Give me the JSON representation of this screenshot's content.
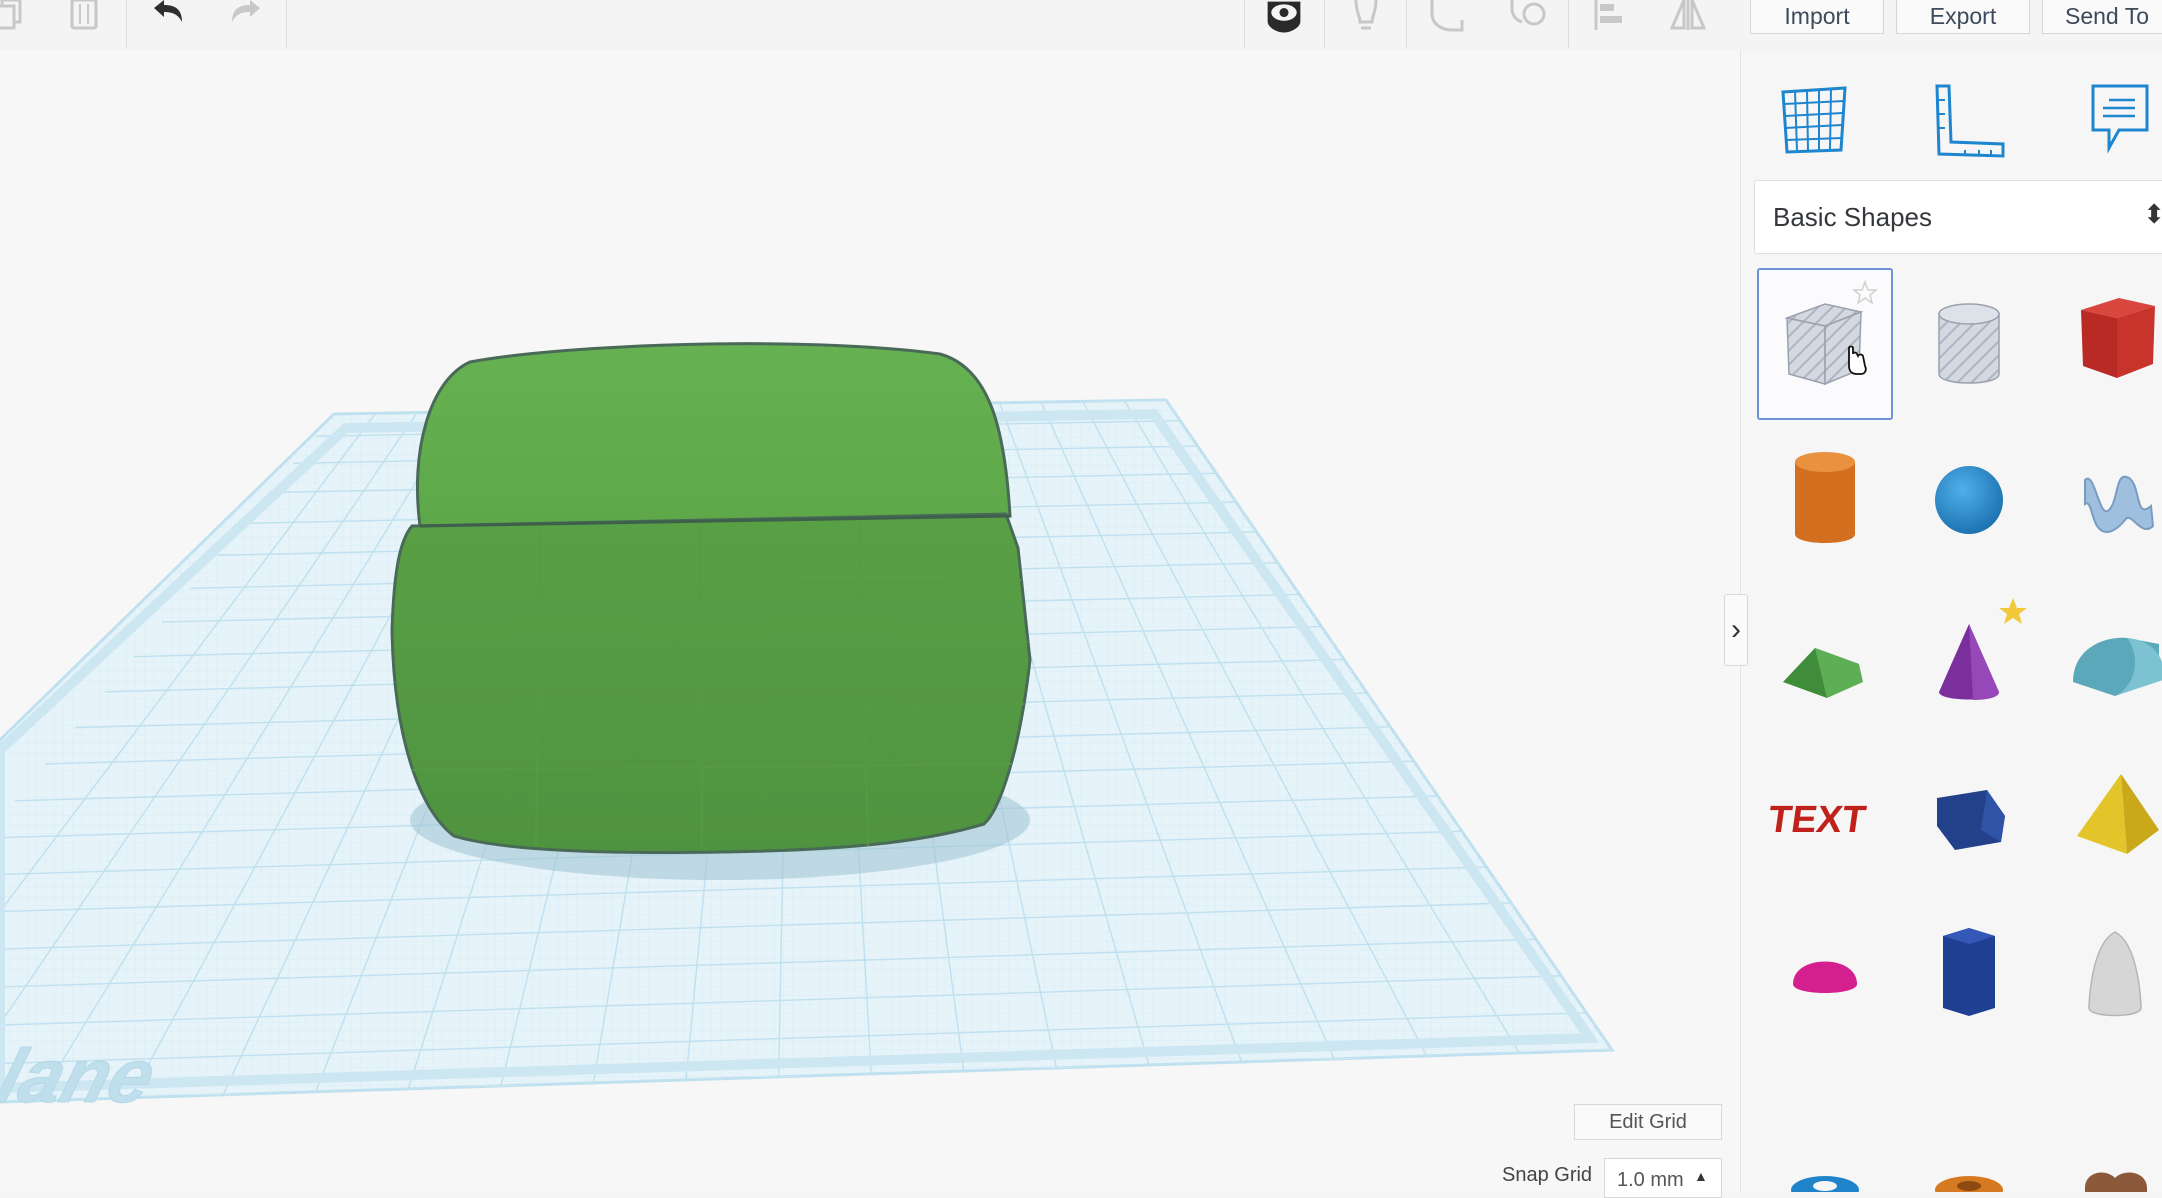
{
  "toolbar": {
    "icons": [
      "copy-icon",
      "delete-icon",
      "undo-icon",
      "redo-icon",
      "show-hide-icon",
      "lightbulb-icon",
      "group-icon",
      "ungroup-icon",
      "align-icon",
      "mirror-icon"
    ],
    "buttons": {
      "import": "Import",
      "export": "Export",
      "send_to": "Send To"
    }
  },
  "viewport": {
    "workplane_label": "Workplane",
    "selected_shape_color": "#5fa64e",
    "grid_color": "#bfe0ef"
  },
  "panel": {
    "tools": [
      "workplane-grid-icon",
      "ruler-icon",
      "notes-icon"
    ],
    "category": "Basic Shapes",
    "shapes": [
      {
        "name": "Box (Hole)",
        "favorite": false,
        "selected": true
      },
      {
        "name": "Cylinder (Hole)",
        "favorite": false,
        "selected": false
      },
      {
        "name": "Box",
        "favorite": false,
        "selected": false
      },
      {
        "name": "Cylinder",
        "favorite": false,
        "selected": false
      },
      {
        "name": "Sphere",
        "favorite": false,
        "selected": false
      },
      {
        "name": "Scribble",
        "favorite": false,
        "selected": false
      },
      {
        "name": "Roof",
        "favorite": false,
        "selected": false
      },
      {
        "name": "Cone",
        "favorite": true,
        "selected": false
      },
      {
        "name": "Round Roof",
        "favorite": false,
        "selected": false
      },
      {
        "name": "Text",
        "favorite": false,
        "selected": false
      },
      {
        "name": "Wedge",
        "favorite": false,
        "selected": false
      },
      {
        "name": "Pyramid",
        "favorite": false,
        "selected": false
      },
      {
        "name": "Half Sphere",
        "favorite": false,
        "selected": false
      },
      {
        "name": "Polygon",
        "favorite": false,
        "selected": false
      },
      {
        "name": "Paraboloid",
        "favorite": false,
        "selected": false
      },
      {
        "name": "Torus",
        "favorite": false,
        "selected": false
      },
      {
        "name": "Tube",
        "favorite": false,
        "selected": false
      },
      {
        "name": "Heart",
        "favorite": false,
        "selected": false
      }
    ]
  },
  "footer": {
    "edit_grid": "Edit Grid",
    "snap_grid_label": "Snap Grid",
    "snap_grid_value": "1.0 mm"
  }
}
